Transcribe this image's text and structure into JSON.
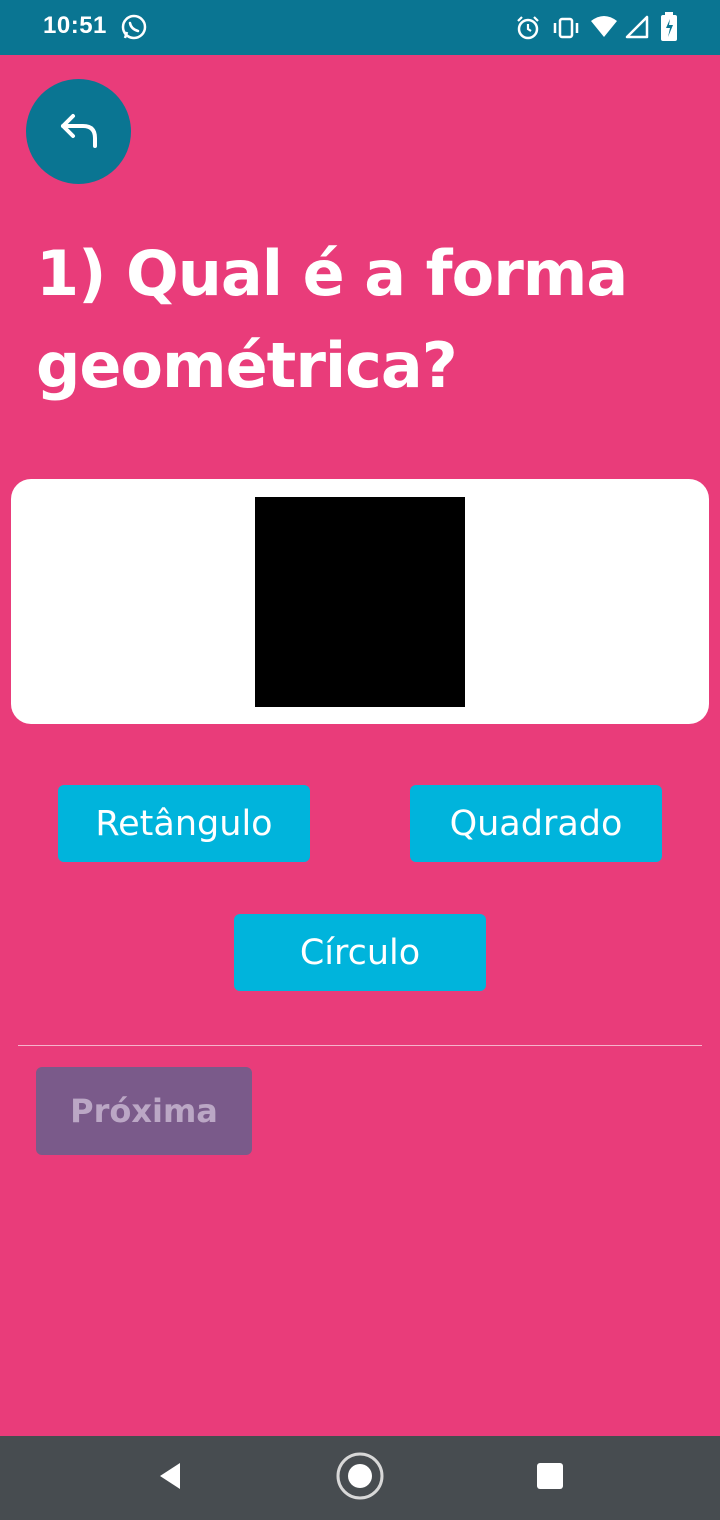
{
  "status_bar": {
    "time": "10:51",
    "icons": [
      "whatsapp-icon",
      "alarm-icon",
      "vibrate-icon",
      "wifi-icon",
      "signal-icon",
      "battery-icon"
    ],
    "background": "#0a7592"
  },
  "back_button": {
    "icon": "back-arrow-icon",
    "color": "#0a7592"
  },
  "question": {
    "text": "1) Qual é a forma geométrica?"
  },
  "image_card": {
    "shape": "square",
    "shape_color": "#000000"
  },
  "answers": [
    {
      "label": "Retângulo"
    },
    {
      "label": "Quadrado"
    },
    {
      "label": "Círculo"
    }
  ],
  "next_button": {
    "label": "Próxima",
    "enabled": false
  },
  "nav_bar": {
    "items": [
      "back-icon",
      "home-icon",
      "recents-icon"
    ]
  },
  "colors": {
    "background": "#e93c7a",
    "answer_button": "#00b4dc",
    "next_disabled": "#7a5a8a"
  }
}
